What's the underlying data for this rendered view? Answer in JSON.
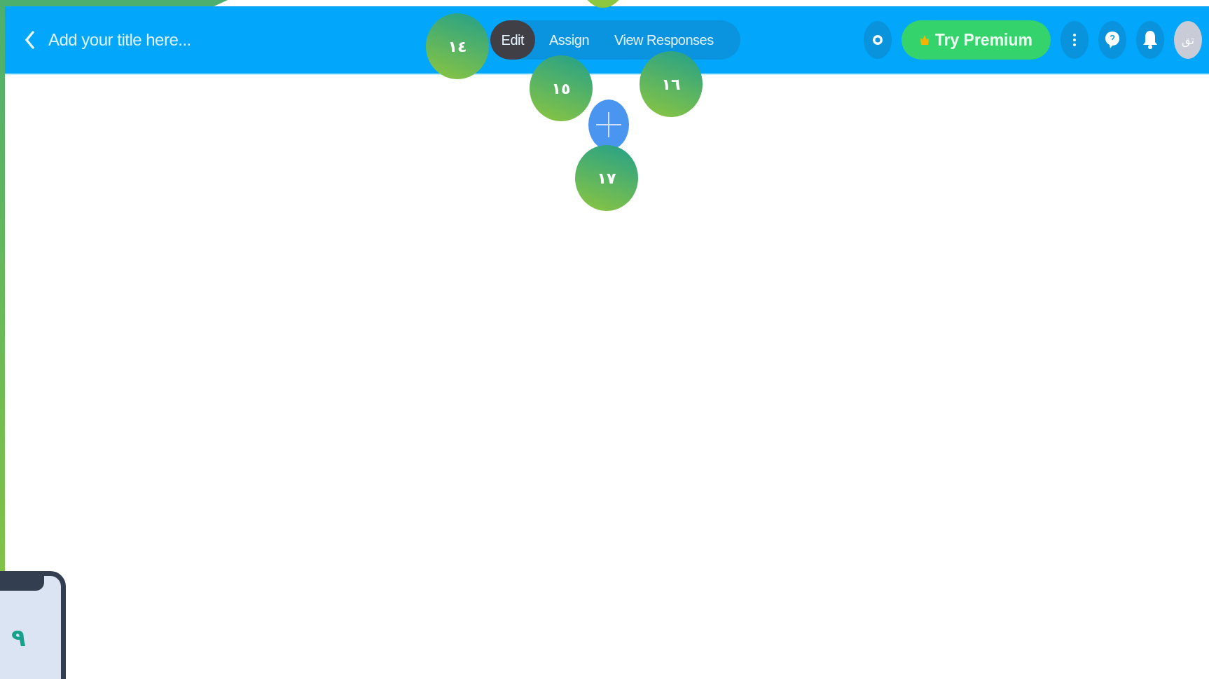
{
  "header": {
    "title_field": {
      "placeholder": "Add your title here..."
    },
    "tabs": [
      {
        "label": "Edit",
        "selected": true
      },
      {
        "label": "Assign",
        "selected": false
      },
      {
        "label": "View Responses",
        "selected": false
      }
    ],
    "premium_button": {
      "label": "Try Premium"
    },
    "avatar": {
      "initials": "تق"
    }
  },
  "markers": [
    {
      "label": "١٤"
    },
    {
      "label": "١٥"
    },
    {
      "label": "١٦"
    },
    {
      "label": "١٧"
    }
  ],
  "phone_marker": {
    "label": "٩"
  }
}
